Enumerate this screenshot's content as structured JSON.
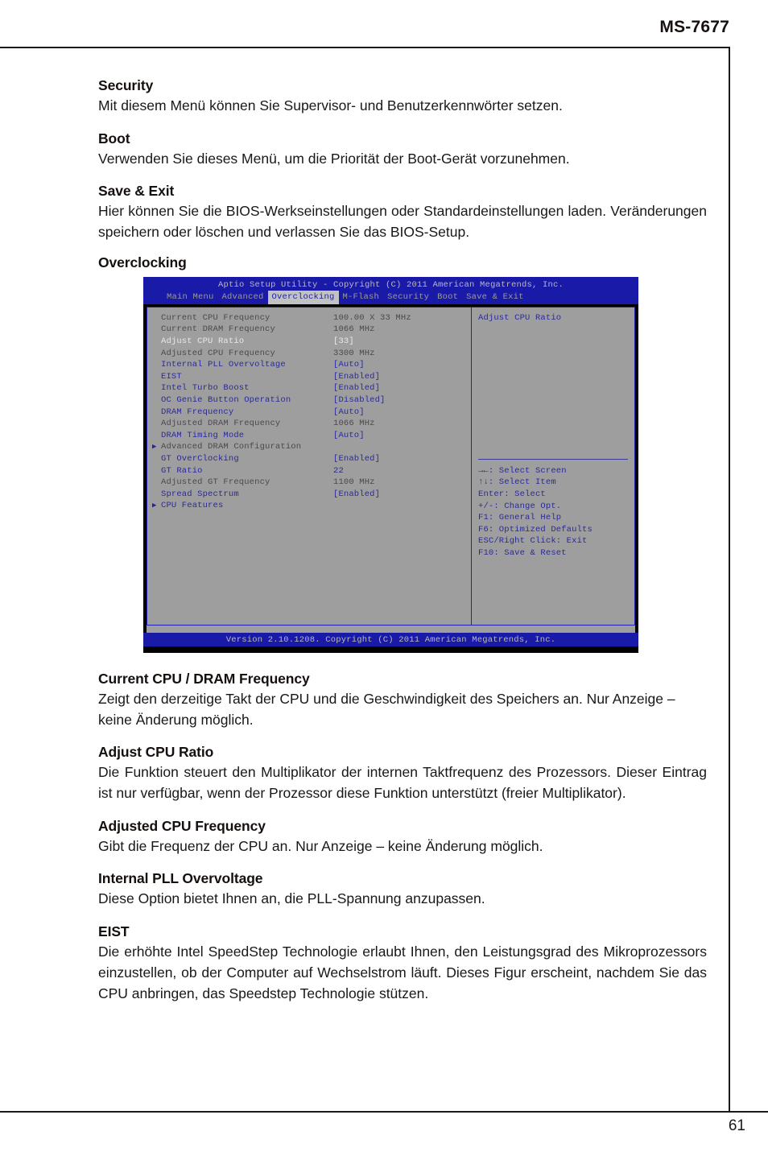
{
  "page": {
    "header_title": "MS-7677",
    "page_number": "61"
  },
  "sections": [
    {
      "title": "Security",
      "body": "Mit diesem Menü können Sie Supervisor- und Benutzerkennwörter setzen."
    },
    {
      "title": "Boot",
      "body": "Verwenden Sie dieses Menü, um die Priorität der Boot-Gerät vorzunehmen."
    },
    {
      "title": "Save & Exit",
      "body": "Hier können Sie die BIOS-Werkseinstellungen oder Standardeinstellungen laden. Veränderungen speichern oder löschen und verlassen Sie das BIOS-Setup."
    },
    {
      "title": "Overclocking",
      "body": ""
    },
    {
      "title": "Current CPU / DRAM Frequency",
      "body": "Zeigt den derzeitige Takt der CPU und die Geschwindigkeit des Speichers an. Nur Anzeige – keine Änderung möglich."
    },
    {
      "title": "Adjust CPU Ratio",
      "body": "Die Funktion steuert den Multiplikator der internen Taktfrequenz des Prozessors. Dieser Eintrag ist nur verfügbar, wenn der Prozessor diese Funktion unterstützt (freier Multiplikator)."
    },
    {
      "title": "Adjusted CPU Frequency",
      "body": "Gibt die Frequenz der CPU an. Nur Anzeige – keine Änderung möglich."
    },
    {
      "title": "Internal PLL Overvoltage",
      "body": "Diese Option bietet Ihnen an, die PLL-Spannung anzupassen."
    },
    {
      "title": "EIST",
      "body": "Die erhöhte Intel SpeedStep Technologie erlaubt Ihnen, den Leistungsgrad des Mikroprozessors einzustellen, ob der Computer auf Wechselstrom läuft. Dieses Figur erscheint, nachdem Sie das CPU anbringen, das Speedstep Technologie stützen."
    }
  ],
  "bios": {
    "title": "Aptio Setup Utility - Copyright (C) 2011 American Megatrends, Inc.",
    "menu_tabs": [
      {
        "label": "Main Menu",
        "active": false
      },
      {
        "label": "Advanced",
        "active": false
      },
      {
        "label": "Overclocking",
        "active": true
      },
      {
        "label": "M-Flash",
        "active": false
      },
      {
        "label": "Security",
        "active": false
      },
      {
        "label": "Boot",
        "active": false
      },
      {
        "label": "Save & Exit",
        "active": false
      }
    ],
    "options": [
      {
        "arrow": "",
        "label": "Current CPU Frequency",
        "value": "100.00 X 33 MHz",
        "style": "dim",
        "selected": false
      },
      {
        "arrow": "",
        "label": "Current DRAM Frequency",
        "value": "1066 MHz",
        "style": "dim",
        "selected": false
      },
      {
        "arrow": "",
        "label": "Adjust CPU Ratio",
        "value": "[33]",
        "style": "sel",
        "selected": true
      },
      {
        "arrow": "",
        "label": "Adjusted CPU Frequency",
        "value": "3300 MHz",
        "style": "dim",
        "selected": false
      },
      {
        "arrow": "",
        "label": "Internal PLL Overvoltage",
        "value": "[Auto]",
        "style": "normal",
        "selected": false
      },
      {
        "arrow": "",
        "label": "EIST",
        "value": "[Enabled]",
        "style": "normal",
        "selected": false
      },
      {
        "arrow": "",
        "label": "Intel Turbo Boost",
        "value": "[Enabled]",
        "style": "normal",
        "selected": false
      },
      {
        "arrow": "",
        "label": "OC Genie Button Operation",
        "value": "[Disabled]",
        "style": "normal",
        "selected": false
      },
      {
        "arrow": "",
        "label": "DRAM Frequency",
        "value": "[Auto]",
        "style": "normal",
        "selected": false
      },
      {
        "arrow": "",
        "label": "Adjusted DRAM Frequency",
        "value": "1066 MHz",
        "style": "dim",
        "selected": false
      },
      {
        "arrow": "",
        "label": "DRAM Timing Mode",
        "value": "[Auto]",
        "style": "normal",
        "selected": false
      },
      {
        "arrow": "▶",
        "label": "Advanced DRAM Configuration",
        "value": "",
        "style": "dim",
        "selected": false
      },
      {
        "arrow": "",
        "label": "GT OverClocking",
        "value": "[Enabled]",
        "style": "normal",
        "selected": false
      },
      {
        "arrow": "",
        "label": "GT Ratio",
        "value": "22",
        "style": "normal",
        "selected": false
      },
      {
        "arrow": "",
        "label": "Adjusted GT Frequency",
        "value": "1100 MHz",
        "style": "dim",
        "selected": false
      },
      {
        "arrow": "",
        "label": "Spread Spectrum",
        "value": "[Enabled]",
        "style": "normal",
        "selected": false
      },
      {
        "arrow": "▶",
        "label": "CPU Features",
        "value": "",
        "style": "normal",
        "selected": false
      }
    ],
    "help_title": "Adjust CPU Ratio",
    "keys": [
      "→←: Select Screen",
      "↑↓: Select Item",
      "Enter: Select",
      "+/-: Change Opt.",
      "F1: General Help",
      "F6: Optimized Defaults",
      "ESC/Right Click: Exit",
      "F10: Save & Reset"
    ],
    "footer": "Version 2.10.1208. Copyright (C) 2011 American Megatrends, Inc."
  },
  "colors": {
    "bios_header_bg": "#1a1aa8",
    "bios_panel_bg": "#9e9e9e",
    "bios_text_blue": "#2a2a9c",
    "bios_text_dim": "#4a4a4a",
    "bios_border": "#2424b4"
  }
}
